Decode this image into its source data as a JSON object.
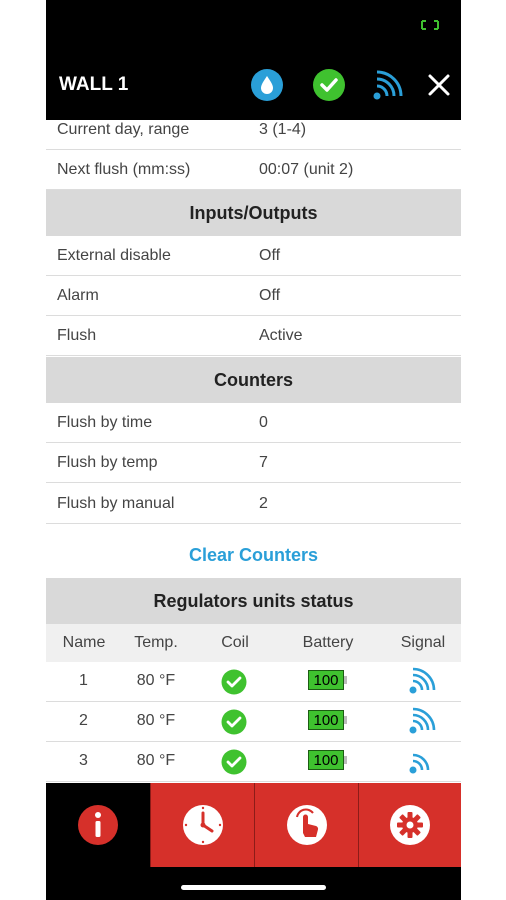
{
  "header": {
    "title": "WALL 1",
    "icons": [
      "water-drop-icon",
      "check-circle-icon",
      "wifi-signal-icon",
      "close-icon"
    ]
  },
  "status_rows": [
    {
      "label": "Current day, range",
      "value": "3 (1-4)"
    },
    {
      "label": "Next flush (mm:ss)",
      "value": "00:07 (unit 2)"
    }
  ],
  "io": {
    "title": "Inputs/Outputs",
    "rows": [
      {
        "label": "External disable",
        "value": "Off"
      },
      {
        "label": "Alarm",
        "value": "Off"
      },
      {
        "label": "Flush",
        "value": "Active"
      }
    ]
  },
  "counters": {
    "title": "Counters",
    "rows": [
      {
        "label": "Flush by time",
        "value": "0"
      },
      {
        "label": "Flush by temp",
        "value": "7"
      },
      {
        "label": "Flush by manual",
        "value": "2"
      }
    ],
    "clear_label": "Clear Counters"
  },
  "regulators": {
    "title": "Regulators units status",
    "columns": [
      "Name",
      "Temp.",
      "Coil",
      "Battery",
      "Signal"
    ],
    "units": [
      {
        "name": "1",
        "temp": "80 °F",
        "coil": "ok",
        "battery": "100",
        "signal": "full"
      },
      {
        "name": "2",
        "temp": "80 °F",
        "coil": "ok",
        "battery": "100",
        "signal": "full"
      },
      {
        "name": "3",
        "temp": "80 °F",
        "coil": "ok",
        "battery": "100",
        "signal": "low"
      }
    ]
  },
  "tabs": [
    {
      "name": "info",
      "icon": "info-icon",
      "active": true
    },
    {
      "name": "schedule",
      "icon": "clock-icon",
      "active": false
    },
    {
      "name": "manual",
      "icon": "touch-icon",
      "active": false
    },
    {
      "name": "settings",
      "icon": "gear-icon",
      "active": false
    }
  ],
  "colors": {
    "accent": "#2a9fd8",
    "tab_red": "#d6302a",
    "ok_green": "#3fc22f",
    "section_bg": "#d9d9d9"
  }
}
